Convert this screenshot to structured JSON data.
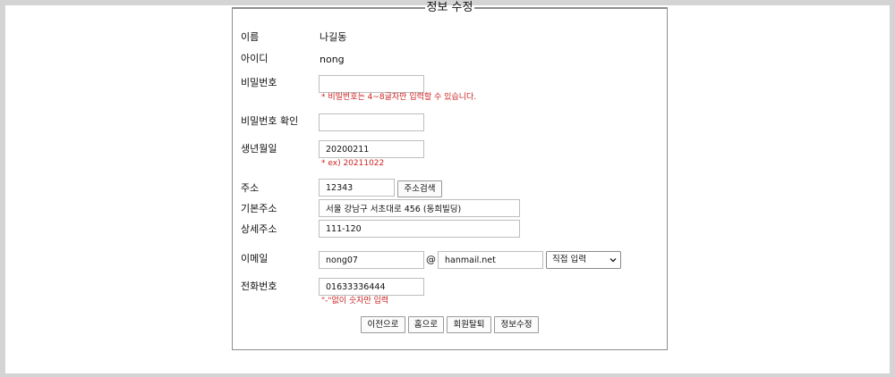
{
  "form": {
    "title": "정보 수정",
    "fields": {
      "name": {
        "label": "이름",
        "value": "나길동"
      },
      "userid": {
        "label": "아이디",
        "value": "nong"
      },
      "password": {
        "label": "비밀번호",
        "value": "",
        "hint": "* 비밀번호는 4~8글자만 입력할 수 있습니다."
      },
      "password_confirm": {
        "label": "비밀번호 확인",
        "value": ""
      },
      "birth": {
        "label": "생년월일",
        "value": "20200211",
        "hint": "* ex) 20211022"
      },
      "zipcode": {
        "label": "주소",
        "value": "12343",
        "search_button": "주소검색"
      },
      "address": {
        "label": "기본주소",
        "value": "서울 강남구 서초대로 456 (동희빌딩)"
      },
      "address_detail": {
        "label": "상세주소",
        "value": "111-120"
      },
      "email": {
        "label": "이메일",
        "local": "nong07",
        "at": "@",
        "domain": "hanmail.net",
        "domain_select": "직접 입력"
      },
      "phone": {
        "label": "전화번호",
        "value": "01633336444",
        "hint": "\"-\"없이 숫자만 입력"
      }
    },
    "buttons": {
      "back": "이전으로",
      "home": "홈으로",
      "withdraw": "회원탈퇴",
      "update": "정보수정"
    }
  }
}
